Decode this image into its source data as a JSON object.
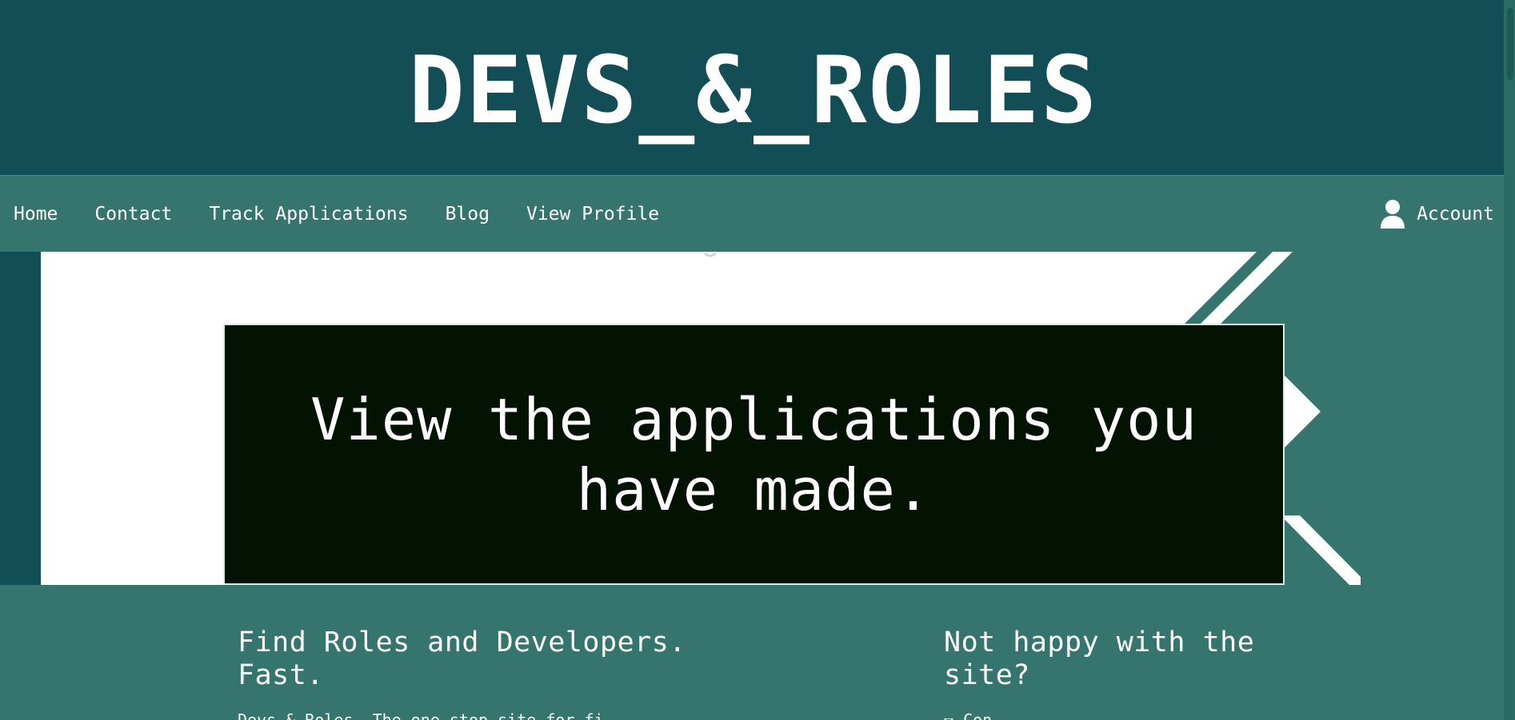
{
  "header": {
    "site_title": "DEVS_&_ROLES"
  },
  "nav": {
    "links": [
      {
        "label": "Home"
      },
      {
        "label": "Contact"
      },
      {
        "label": "Track Applications"
      },
      {
        "label": "Blog"
      },
      {
        "label": "View Profile"
      }
    ],
    "account_label": "Account",
    "account_icon": "user-icon"
  },
  "hero": {
    "text": "View the applications you have made."
  },
  "footer": {
    "left_heading": "Find Roles and Developers. Fast.",
    "left_text": "Devs & Roles. The one-stop site for fi…",
    "right_heading": "Not happy with the site?",
    "right_text": "✉ Con…"
  },
  "colors": {
    "header_bg": "#134e56",
    "nav_bg": "#35756d",
    "hero_box_bg": "#031203",
    "text": "#ffffff"
  }
}
